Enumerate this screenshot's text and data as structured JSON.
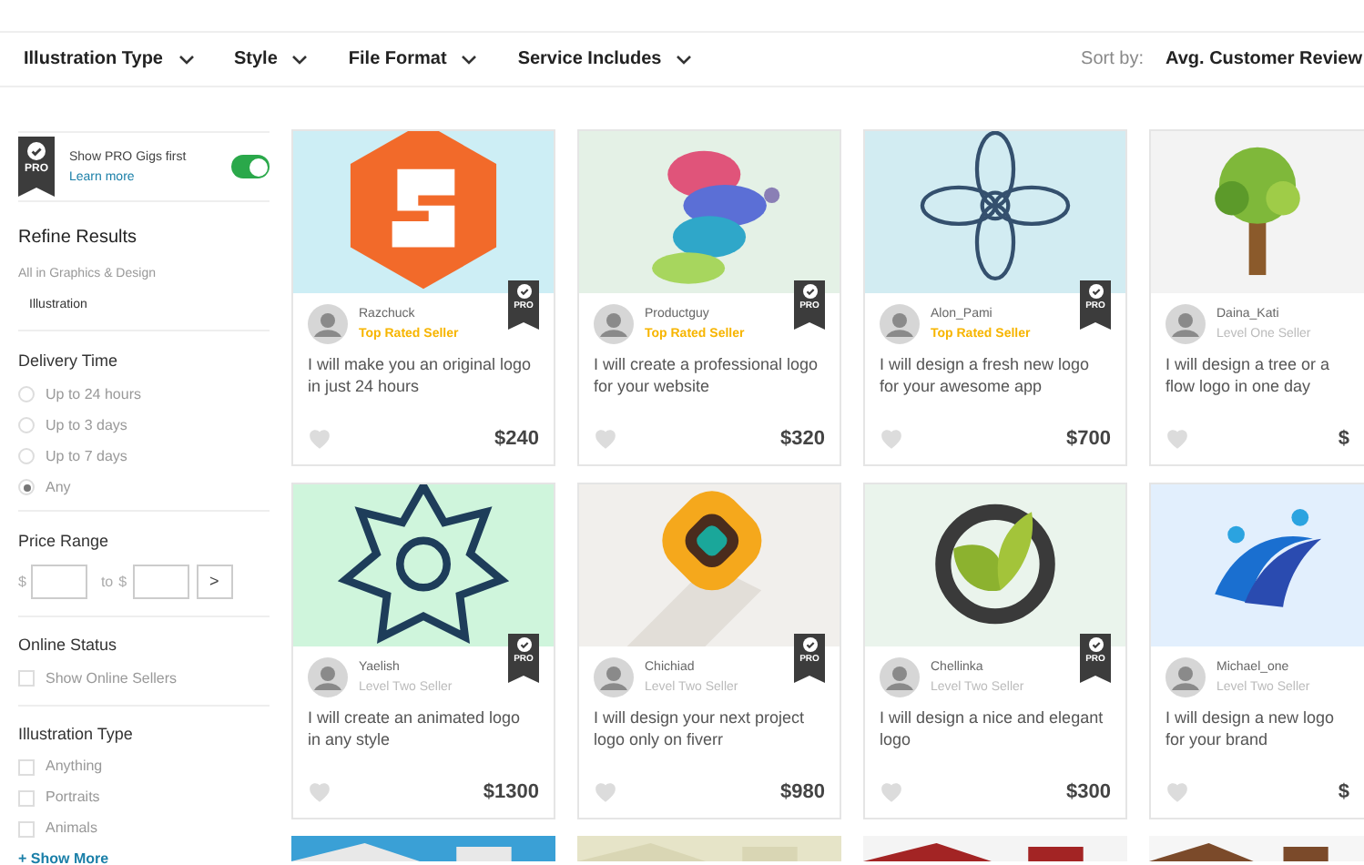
{
  "filters": [
    {
      "label": "Illustration Type"
    },
    {
      "label": "Style"
    },
    {
      "label": "File Format"
    },
    {
      "label": "Service Includes"
    }
  ],
  "sort": {
    "label": "Sort by:",
    "value": "Avg. Customer Review"
  },
  "pro_toggle": {
    "badge": "PRO",
    "label": "Show PRO Gigs first",
    "link": "Learn more",
    "on": true
  },
  "refine": {
    "title": "Refine Results",
    "category": "All in Graphics & Design",
    "subcategory": "Illustration"
  },
  "delivery": {
    "title": "Delivery Time",
    "options": [
      {
        "label": "Up to 24 hours",
        "selected": false
      },
      {
        "label": "Up to 3 days",
        "selected": false
      },
      {
        "label": "Up to 7 days",
        "selected": false
      },
      {
        "label": "Any",
        "selected": true
      }
    ]
  },
  "price": {
    "title": "Price Range",
    "currency": "$",
    "to": "to",
    "go": ">"
  },
  "online": {
    "title": "Online Status",
    "options": [
      {
        "label": "Show Online Sellers",
        "checked": false
      }
    ]
  },
  "illustration_type": {
    "title": "Illustration Type",
    "options": [
      {
        "label": "Anything",
        "checked": false
      },
      {
        "label": "Portraits",
        "checked": false
      },
      {
        "label": "Animals",
        "checked": false
      }
    ],
    "more": "+ Show More"
  },
  "gigs": [
    {
      "seller": "Razchuck",
      "level": "Top Rated Seller",
      "top_rated": true,
      "badge": "PRO",
      "title": "I will make you an original logo in just 24 hours",
      "price": "$240"
    },
    {
      "seller": "Productguy",
      "level": "Top Rated Seller",
      "top_rated": true,
      "badge": "PRO",
      "title": "I will create a professional logo for your website",
      "price": "$320"
    },
    {
      "seller": "Alon_Pami",
      "level": "Top Rated Seller",
      "top_rated": true,
      "badge": "PRO",
      "title": "I will design a fresh new logo for your awesome app",
      "price": "$700"
    },
    {
      "seller": "Daina_Kati",
      "level": "Level One Seller",
      "top_rated": false,
      "title": "I will design a tree or a flow logo in one day",
      "price": "$"
    },
    {
      "seller": "Yaelish",
      "level": "Level Two Seller",
      "top_rated": false,
      "badge": "PRO",
      "title": "I will create an animated logo in any style",
      "price": "$1300"
    },
    {
      "seller": "Chichiad",
      "level": "Level Two Seller",
      "top_rated": false,
      "badge": "PRO",
      "title": "I will design your next project logo only on fiverr",
      "price": "$980"
    },
    {
      "seller": "Chellinka",
      "level": "Level Two Seller",
      "top_rated": false,
      "badge": "PRO",
      "title": "I will design a nice and elegant logo",
      "price": "$300"
    },
    {
      "seller": "Michael_one",
      "level": "Level Two Seller",
      "top_rated": false,
      "title": "I will design a new logo for your brand",
      "price": "$"
    }
  ]
}
